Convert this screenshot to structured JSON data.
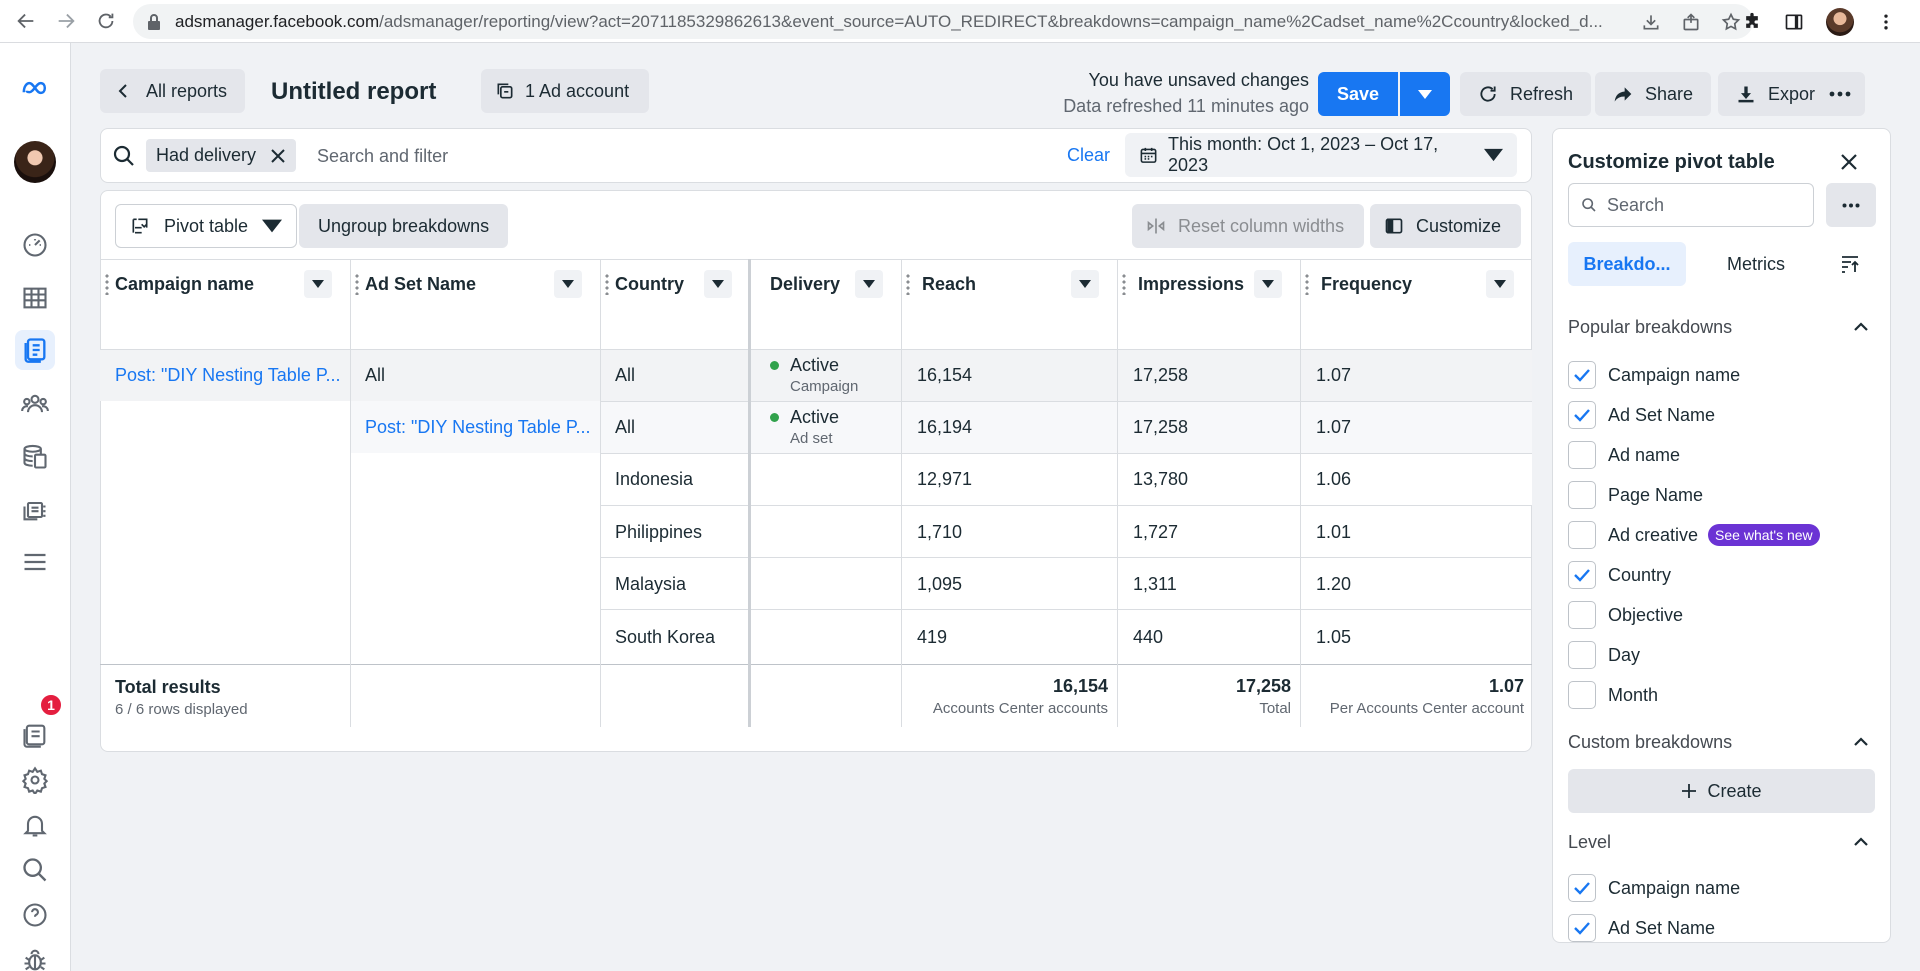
{
  "browser": {
    "url_host": "adsmanager.facebook.com",
    "url_path": "/adsmanager/reporting/view?act=2071185329862613&event_source=AUTO_REDIRECT&breakdowns=campaign_name%2Cadset_name%2Ccountry&locked_d..."
  },
  "header": {
    "back_label": "All reports",
    "title": "Untitled report",
    "account_label": "1 Ad account",
    "unsaved_text": "You have unsaved changes",
    "refreshed_text": "Data refreshed 11 minutes ago",
    "save_label": "Save",
    "refresh_label": "Refresh",
    "share_label": "Share",
    "export_label": "Export"
  },
  "filter": {
    "chip_label": "Had delivery",
    "search_placeholder": "Search and filter",
    "clear_label": "Clear",
    "date_label": "This month: Oct 1, 2023 – Oct 17, 2023"
  },
  "toolbar": {
    "pivot_label": "Pivot table",
    "ungroup_label": "Ungroup breakdowns",
    "reset_label": "Reset column widths",
    "customize_label": "Customize"
  },
  "table": {
    "columns": [
      "Campaign name",
      "Ad Set Name",
      "Country",
      "Delivery",
      "Reach",
      "Impressions",
      "Frequency"
    ],
    "rows": [
      {
        "campaign": "Post: \"DIY Nesting Table P...",
        "adset": "All",
        "country": "All",
        "delivery": "Active",
        "delivery_sub": "Campaign",
        "reach": "16,154",
        "impressions": "17,258",
        "frequency": "1.07"
      },
      {
        "campaign": "",
        "adset": "Post: \"DIY Nesting Table P...",
        "country": "All",
        "delivery": "Active",
        "delivery_sub": "Ad set",
        "reach": "16,194",
        "impressions": "17,258",
        "frequency": "1.07"
      },
      {
        "campaign": "",
        "adset": "",
        "country": "Indonesia",
        "delivery": "",
        "delivery_sub": "",
        "reach": "12,971",
        "impressions": "13,780",
        "frequency": "1.06"
      },
      {
        "campaign": "",
        "adset": "",
        "country": "Philippines",
        "delivery": "",
        "delivery_sub": "",
        "reach": "1,710",
        "impressions": "1,727",
        "frequency": "1.01"
      },
      {
        "campaign": "",
        "adset": "",
        "country": "Malaysia",
        "delivery": "",
        "delivery_sub": "",
        "reach": "1,095",
        "impressions": "1,311",
        "frequency": "1.20"
      },
      {
        "campaign": "",
        "adset": "",
        "country": "South Korea",
        "delivery": "",
        "delivery_sub": "",
        "reach": "419",
        "impressions": "440",
        "frequency": "1.05"
      }
    ],
    "totals": {
      "label": "Total results",
      "sub": "6 / 6 rows displayed",
      "reach": "16,154",
      "reach_desc": "Accounts Center accounts",
      "impressions": "17,258",
      "impressions_desc": "Total",
      "frequency": "1.07",
      "frequency_desc": "Per Accounts Center account"
    }
  },
  "panel": {
    "title": "Customize pivot table",
    "search_placeholder": "Search",
    "tab_breakdowns": "Breakdo...",
    "tab_metrics": "Metrics",
    "popular_title": "Popular breakdowns",
    "popular": [
      {
        "label": "Campaign name",
        "checked": true
      },
      {
        "label": "Ad Set Name",
        "checked": true
      },
      {
        "label": "Ad name",
        "checked": false
      },
      {
        "label": "Page Name",
        "checked": false
      },
      {
        "label": "Ad creative",
        "checked": false,
        "badge": "See what's new"
      },
      {
        "label": "Country",
        "checked": true
      },
      {
        "label": "Objective",
        "checked": false
      },
      {
        "label": "Day",
        "checked": false
      },
      {
        "label": "Month",
        "checked": false
      }
    ],
    "custom_title": "Custom breakdowns",
    "create_label": "Create",
    "level_title": "Level",
    "level": [
      {
        "label": "Campaign name",
        "checked": true
      },
      {
        "label": "Ad Set Name",
        "checked": true
      }
    ]
  },
  "nav": {
    "notification_count": "1"
  },
  "colors": {
    "accent": "#1877f2",
    "active_status": "#31a24c",
    "badge_purple": "#6b33d4",
    "notif_red": "#e41e3f"
  }
}
